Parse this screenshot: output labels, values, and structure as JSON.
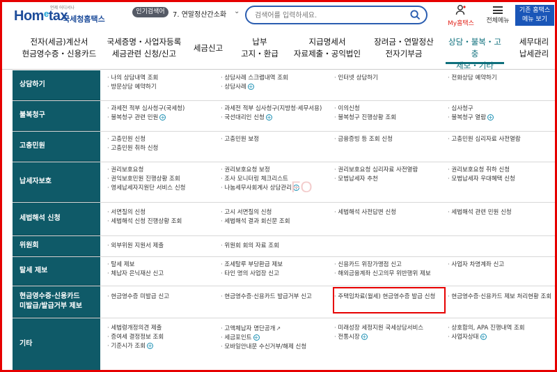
{
  "header": {
    "logo_tagline": "언제 어디서나",
    "logo_home": "Hom",
    "logo_e": "e",
    "logo_tax": "tax",
    "logo_name": "국세청홈택스",
    "popular_badge": "인기검색어",
    "popular_item": "7.  연말정산간소화",
    "search_placeholder": "검색어를 입력하세요.",
    "my_tax": "My홈택스",
    "all_menu": "전체메뉴",
    "legacy_line1": "기존 홈택스",
    "legacy_line2": "메뉴 보기"
  },
  "gnb": [
    {
      "label": "전자(세금)계산서\n현금영수증・신용카드"
    },
    {
      "label": "국세증명・사업자등록\n세금관련 신청/신고"
    },
    {
      "label": "세금신고"
    },
    {
      "label": "납부\n고지・환급"
    },
    {
      "label": "지급명세서\n자료제출・공익법인"
    },
    {
      "label": "장려금・연말정산\n전자기부금"
    },
    {
      "label": "상담・불복・고충\n제보・기타",
      "active": true
    },
    {
      "label": "세무대리\n납세관리"
    }
  ],
  "watermark": "FO",
  "rows": [
    {
      "category": "상담하기",
      "cols": [
        [
          {
            "t": "나의 상담내역 조회"
          },
          {
            "t": "방문상담 예약하기"
          }
        ],
        [
          {
            "t": "상담사례 스크랩내역 조회"
          },
          {
            "t": "상담사례",
            "plus": true
          }
        ],
        [
          {
            "t": "인터넷 상담하기"
          }
        ],
        [
          {
            "t": "전화상담 예약하기"
          }
        ]
      ]
    },
    {
      "category": "불복청구",
      "cols": [
        [
          {
            "t": "과세전 적부 심사청구(국세청)"
          },
          {
            "t": "불복청구 관련 민원",
            "plus": true
          }
        ],
        [
          {
            "t": "과세전 적부 심사청구(지방청·세무서용)"
          },
          {
            "t": "국선대리인 신청",
            "plus": true
          }
        ],
        [
          {
            "t": "이의신청"
          },
          {
            "t": "불복청구 진행상황 조회"
          }
        ],
        [
          {
            "t": "심사청구"
          },
          {
            "t": "불복청구 열람",
            "plus": true
          }
        ]
      ]
    },
    {
      "category": "고충민원",
      "cols": [
        [
          {
            "t": "고충민원 신청"
          },
          {
            "t": "고충민원 취하 신청"
          }
        ],
        [
          {
            "t": "고충민원 보정"
          }
        ],
        [
          {
            "t": "금융증빙 등 조회 신청"
          }
        ],
        [
          {
            "t": "고충민원 심리자료 사전열람"
          }
        ]
      ]
    },
    {
      "category": "납세자보호",
      "cols": [
        [
          {
            "t": "권리보호요청"
          },
          {
            "t": "권익보호민원 진행상황 조회"
          },
          {
            "t": "영세납세자지원단 서비스 신청"
          }
        ],
        [
          {
            "t": "권리보호요청 보정"
          },
          {
            "t": "조사 모니터링 체크리스트"
          },
          {
            "t": "나눔세무사회계사 상담관리",
            "plus": true
          }
        ],
        [
          {
            "t": "권리보호요청 심리자료 사전열람"
          },
          {
            "t": "모범납세자 추천"
          }
        ],
        [
          {
            "t": "권리보호요청 취하 신청"
          },
          {
            "t": "모범납세자 우대혜택 신청"
          }
        ]
      ]
    },
    {
      "category": "세법해석 신청",
      "cols": [
        [
          {
            "t": "서면질의 신청"
          },
          {
            "t": "세법해석 신청 진행상황 조회"
          }
        ],
        [
          {
            "t": "고시 서면질의 신청"
          },
          {
            "t": "세법해석 결과 회신문 조회"
          }
        ],
        [
          {
            "t": "세법해석 사전답변 신청"
          }
        ],
        [
          {
            "t": "세법해석 관련 민원 신청"
          }
        ]
      ]
    },
    {
      "category": "위원회",
      "cols": [
        [
          {
            "t": "외부위원 지원서 제출"
          }
        ],
        [
          {
            "t": "위원회 회의 자료 조회"
          }
        ],
        [],
        []
      ]
    },
    {
      "category": "탈세 제보",
      "cols": [
        [
          {
            "t": "탈세 제보"
          },
          {
            "t": "체납자 은닉재산 신고"
          }
        ],
        [
          {
            "t": "조세탈루 부당환급 제보"
          },
          {
            "t": "타인 명의 사업장 신고"
          }
        ],
        [
          {
            "t": "신용카드 위장가맹점 신고"
          },
          {
            "t": "해외금융계좌 신고의무 위반행위 제보"
          }
        ],
        [
          {
            "t": "사업자 차명계좌 신고"
          }
        ]
      ]
    },
    {
      "category": "현금영수증·신용카드\n미발급/발급거부 제보",
      "cols": [
        [
          {
            "t": "현금영수증 미발급 신고"
          }
        ],
        [
          {
            "t": "현금영수증·신용카드 발급거부 신고"
          }
        ],
        [
          {
            "t": "주택임차료(월세) 현금영수증 발급 신청"
          }
        ],
        [
          {
            "t": "현금영수증·신용카드 제보 처리현황 조회"
          }
        ]
      ]
    },
    {
      "category": "기타",
      "cols": [
        [
          {
            "t": "세법령개정의견 제출"
          },
          {
            "t": "증여세 결정정보 조회"
          },
          {
            "t": "기준시가 조회",
            "plus": true
          }
        ],
        [
          {
            "t": "고액체납자 명단공개",
            "ext": true
          },
          {
            "t": "세금포인트",
            "plus": true
          },
          {
            "t": "모바일안내문 수신거부/해제 신청"
          }
        ],
        [
          {
            "t": "미래성장 세정지원 국세상담서비스"
          },
          {
            "t": "전통시장",
            "plus": true
          }
        ],
        [
          {
            "t": "상호합의, APA 진행내역 조회"
          },
          {
            "t": "사업자상태",
            "plus": true
          }
        ]
      ]
    }
  ]
}
